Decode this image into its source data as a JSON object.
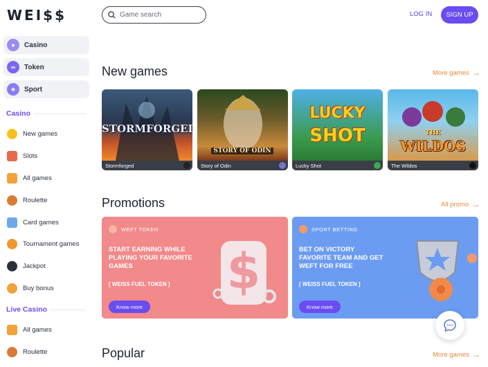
{
  "brand": {
    "logo": "WEI$$"
  },
  "colors": {
    "accent": "#6a4cf0",
    "orange": "#e8873a",
    "promo1": "#f2898a",
    "promo2": "#6b9cf2"
  },
  "top_nav": [
    {
      "label": "Casino",
      "icon": "cherry-icon"
    },
    {
      "label": "Token",
      "icon": "token-icon"
    },
    {
      "label": "Sport",
      "icon": "trophy-icon"
    }
  ],
  "casino_section": {
    "title": "Casino",
    "items": [
      {
        "label": "New games",
        "icon": "new-badge-icon"
      },
      {
        "label": "Slots",
        "icon": "slot-machine-icon"
      },
      {
        "label": "All games",
        "icon": "dice-icon"
      },
      {
        "label": "Roulette",
        "icon": "roulette-icon"
      },
      {
        "label": "Card games",
        "icon": "cards-icon"
      },
      {
        "label": "Tournament games",
        "icon": "tournament-icon"
      },
      {
        "label": "Jackpot",
        "icon": "bomb-icon"
      },
      {
        "label": "Buy bonus",
        "icon": "bonus-icon"
      }
    ]
  },
  "live_section": {
    "title": "Live Casino",
    "items": [
      {
        "label": "All games",
        "icon": "dice-icon"
      },
      {
        "label": "Roulette",
        "icon": "roulette-icon"
      }
    ]
  },
  "header": {
    "search_placeholder": "Game search",
    "login": "LOG IN",
    "signup": "SIGN UP"
  },
  "new_games": {
    "title": "New games",
    "more": "More games",
    "games": [
      {
        "name": "Stormforged",
        "art_text": "STORMFORGED"
      },
      {
        "name": "Story of Odin",
        "art_text": "STORY OF ODIN"
      },
      {
        "name": "Lucky Shot",
        "art_text_1": "LUCKY",
        "art_text_2": "SHOT"
      },
      {
        "name": "The Wildos",
        "art_text_1": "THE",
        "art_text_2": "WILDOS"
      }
    ]
  },
  "promotions": {
    "title": "Promotions",
    "more": "All promo",
    "items": [
      {
        "tag": "WEFT TOKEN",
        "headline": "START EARNING WHILE PLAYING YOUR FAVORITE GAMES",
        "sub": "[ WEISS FUEL TOKEN ]",
        "button": "Know more"
      },
      {
        "tag": "SPORT BETTING",
        "headline": "BET ON VICTORY FAVORITE TEAM AND GET WEFT FOR FREE",
        "sub": "[ WEISS FUEL TOKEN ]",
        "button": "Know more"
      }
    ]
  },
  "popular": {
    "title": "Popular",
    "more": "More games"
  }
}
